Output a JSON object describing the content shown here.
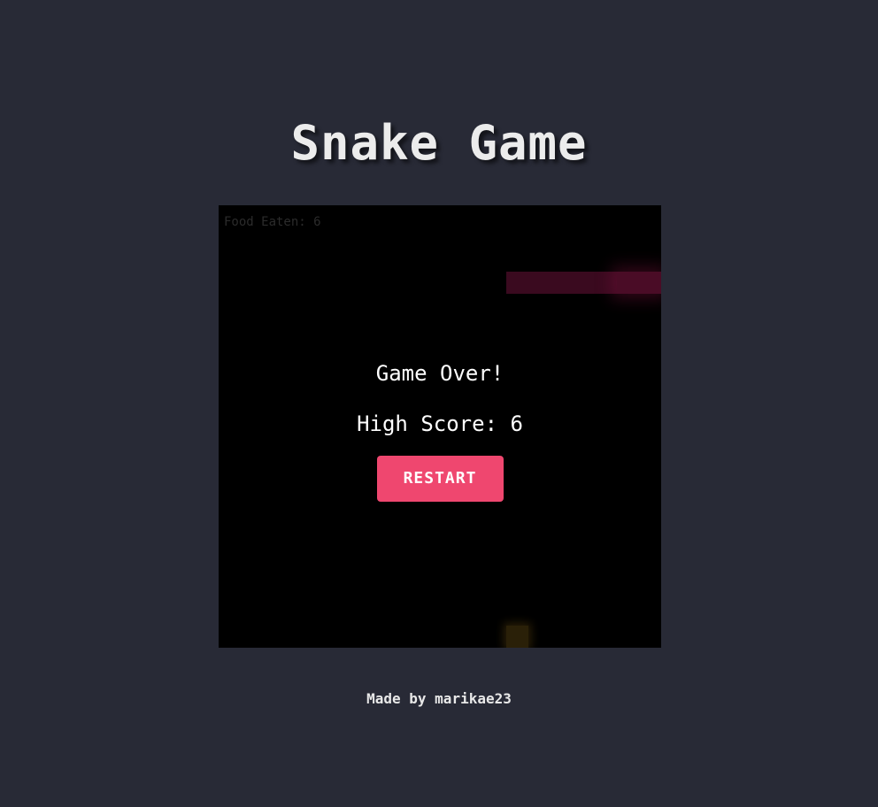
{
  "page": {
    "title": "Snake Game",
    "footer": "Made by marikae23"
  },
  "game": {
    "food_eaten_label": "Food Eaten: 6",
    "food_eaten": 6,
    "game_over_text": "Game Over!",
    "high_score_text": "High Score: 6",
    "high_score": 6,
    "restart_label": "RESTART"
  },
  "colors": {
    "background": "#282a36",
    "board": "#000000",
    "snake": "#4a0c26",
    "food": "#2a2008",
    "button": "#ef476f"
  }
}
